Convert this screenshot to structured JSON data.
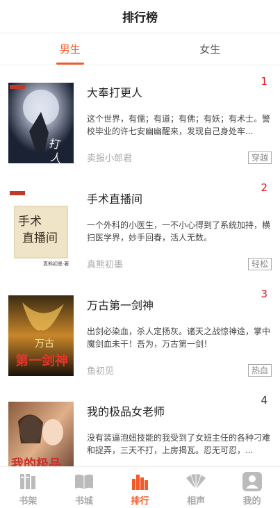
{
  "header": {
    "title": "排行榜"
  },
  "tabs": [
    {
      "label": "男生",
      "active": true
    },
    {
      "label": "女生",
      "active": false
    }
  ],
  "books": [
    {
      "rank": "1",
      "title": "大奉打更人",
      "desc": "这个世界，有儒；有道；有佛；有妖；有术士。警校毕业的许七安幽幽醒来，发现自己身处牢...",
      "author": "卖报小郎君",
      "tag": "穿越",
      "cover_text": "打更人"
    },
    {
      "rank": "2",
      "title": "手术直播间",
      "desc": "一个外科的小医生，一不小心得到了系统加持，横扫医学界，妙手回春，活人无数。",
      "author": "真熊初墨",
      "tag": "轻松",
      "cover_text": "手术直播间"
    },
    {
      "rank": "3",
      "title": "万古第一剑神",
      "desc": "出剑必染血，杀人定扬灰。诸天之战惊神途，掌中魔剑血未干！吾为，万古第一剑！",
      "author": "鱼初见",
      "tag": "热血",
      "cover_text": "万古第一剑神"
    },
    {
      "rank": "4",
      "title": "我的极品女老师",
      "desc": "没有装逼泡妞技能的我受到了女班主任的各种刁难和捉弄，三天不打，上房揭瓦。忍无可忍，...",
      "author": "",
      "tag": "",
      "cover_text": "我的极品女老师"
    }
  ],
  "nav": [
    {
      "label": "书架",
      "icon": "bookshelf-icon"
    },
    {
      "label": "书城",
      "icon": "open-book-icon"
    },
    {
      "label": "排行",
      "icon": "ranking-icon",
      "active": true
    },
    {
      "label": "相声",
      "icon": "fan-icon"
    },
    {
      "label": "我的",
      "icon": "user-icon"
    }
  ],
  "colors": {
    "accent": "#f25a29",
    "rank_hot": "#e3141b",
    "muted": "#aaaaaa"
  }
}
